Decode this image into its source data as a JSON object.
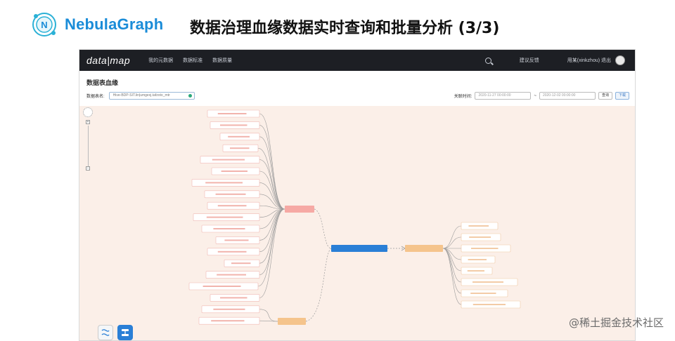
{
  "slide": {
    "brand": "NebulaGraph",
    "title": "数据治理血缘数据实时查询和批量分析 (3/3)",
    "watermark": "@稀土掘金技术社区"
  },
  "app": {
    "logo": "data|map",
    "nav": [
      "我的元数据",
      "数据标准",
      "数据质量"
    ],
    "feedback": "建议反馈",
    "user": "用某(xinkzhou) 退出"
  },
  "page": {
    "title": "数据表血缘",
    "table_label": "数据表名:",
    "table_value": "Hive-BDP-SIT.lin|umgexj.tafzoto_mtr",
    "time_label": "关联时间:",
    "start_date": "2020-11-27 00:00:00",
    "range_sep": "~",
    "end_date": "2020-12-02 00:00:00",
    "query_button": "查询",
    "download_button": "下载"
  },
  "colors": {
    "canvas_bg": "#fbefe8",
    "source_node": "#f6a9a4",
    "center_node": "#2a7fd6",
    "target_node": "#f5c48c",
    "edge": "#9a9a9a"
  },
  "graph": {
    "left_leaf_count": 19,
    "right_leaf_count": 8
  }
}
